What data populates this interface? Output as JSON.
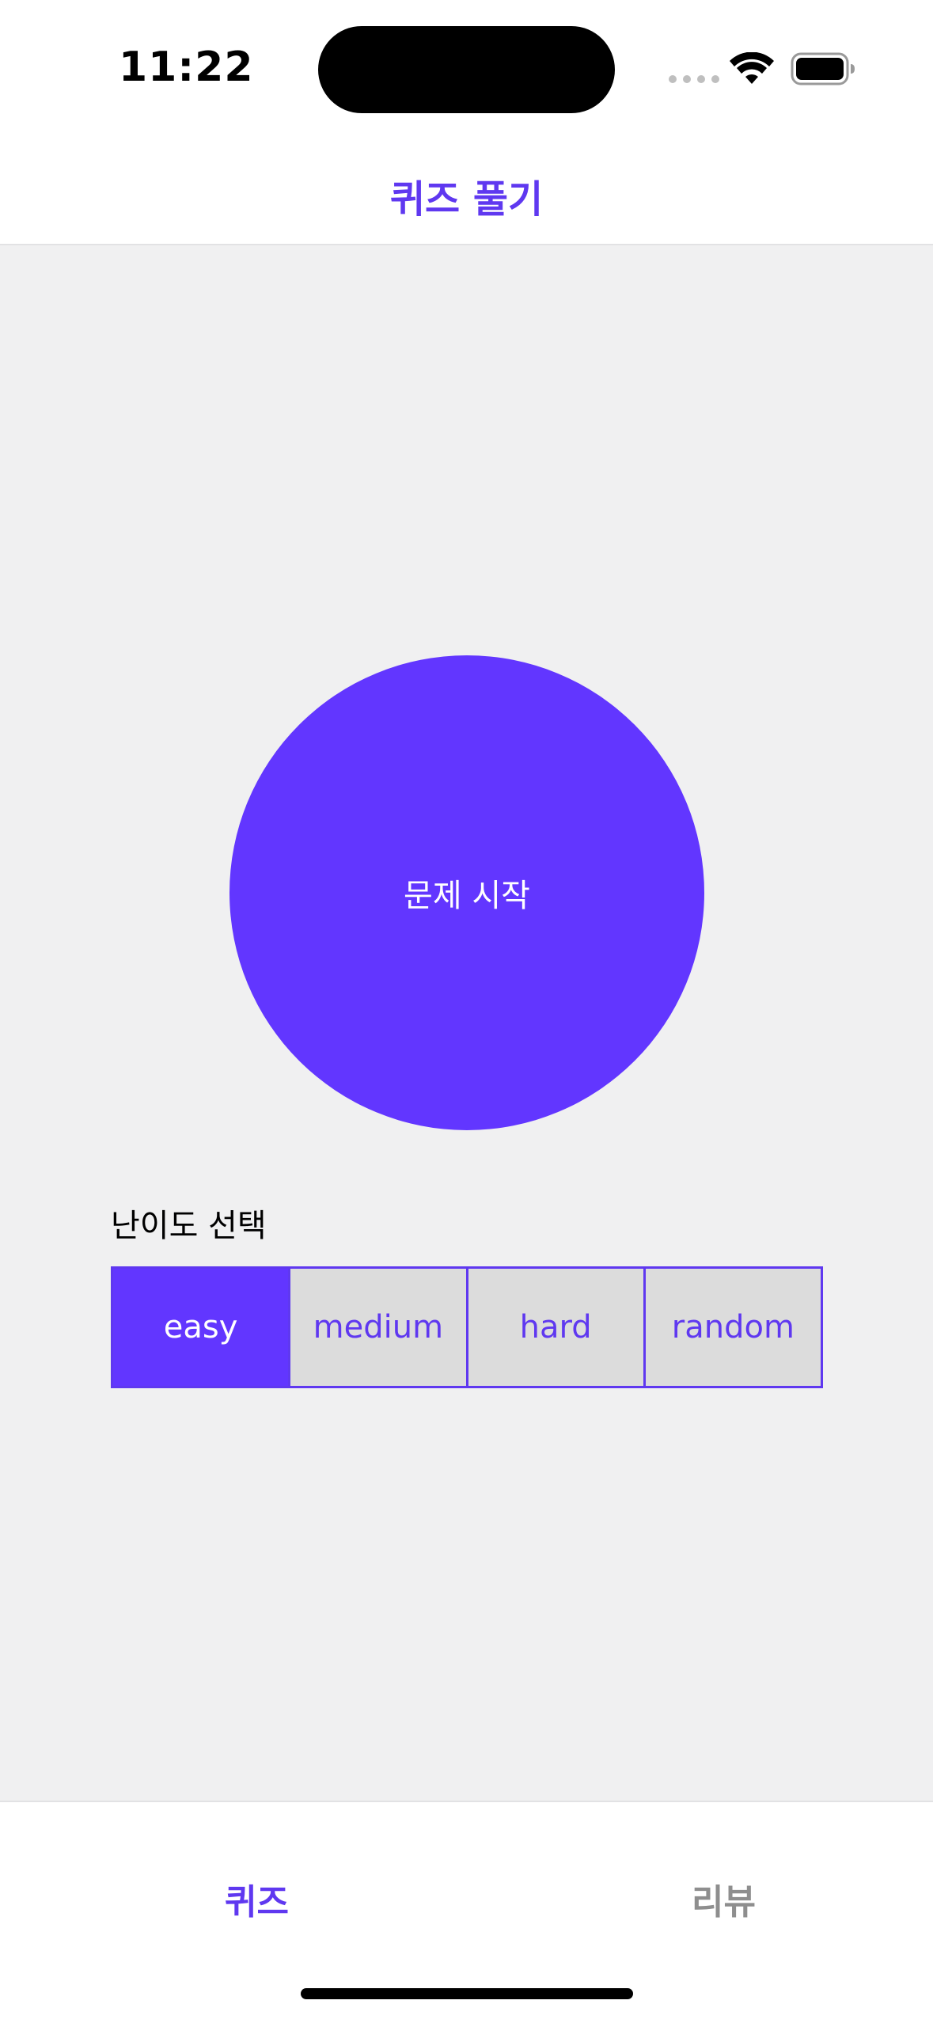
{
  "status_bar": {
    "time": "11:22"
  },
  "nav": {
    "title": "퀴즈 풀기"
  },
  "main": {
    "start_button_label": "문제 시작",
    "difficulty_label": "난이도 선택",
    "difficulty_options": [
      "easy",
      "medium",
      "hard",
      "random"
    ],
    "selected_difficulty": "easy"
  },
  "tab_bar": {
    "tabs": [
      {
        "label": "퀴즈",
        "active": true
      },
      {
        "label": "리뷰",
        "active": false
      }
    ]
  },
  "colors": {
    "accent": "#6236ff",
    "tint": "#5f38f0",
    "background": "#f0f0f1",
    "segment_unselected": "#dcdcdc",
    "inactive_tab": "#8e8e8e"
  },
  "icons": [
    "cellular-signal-icon",
    "wifi-icon",
    "battery-icon"
  ]
}
